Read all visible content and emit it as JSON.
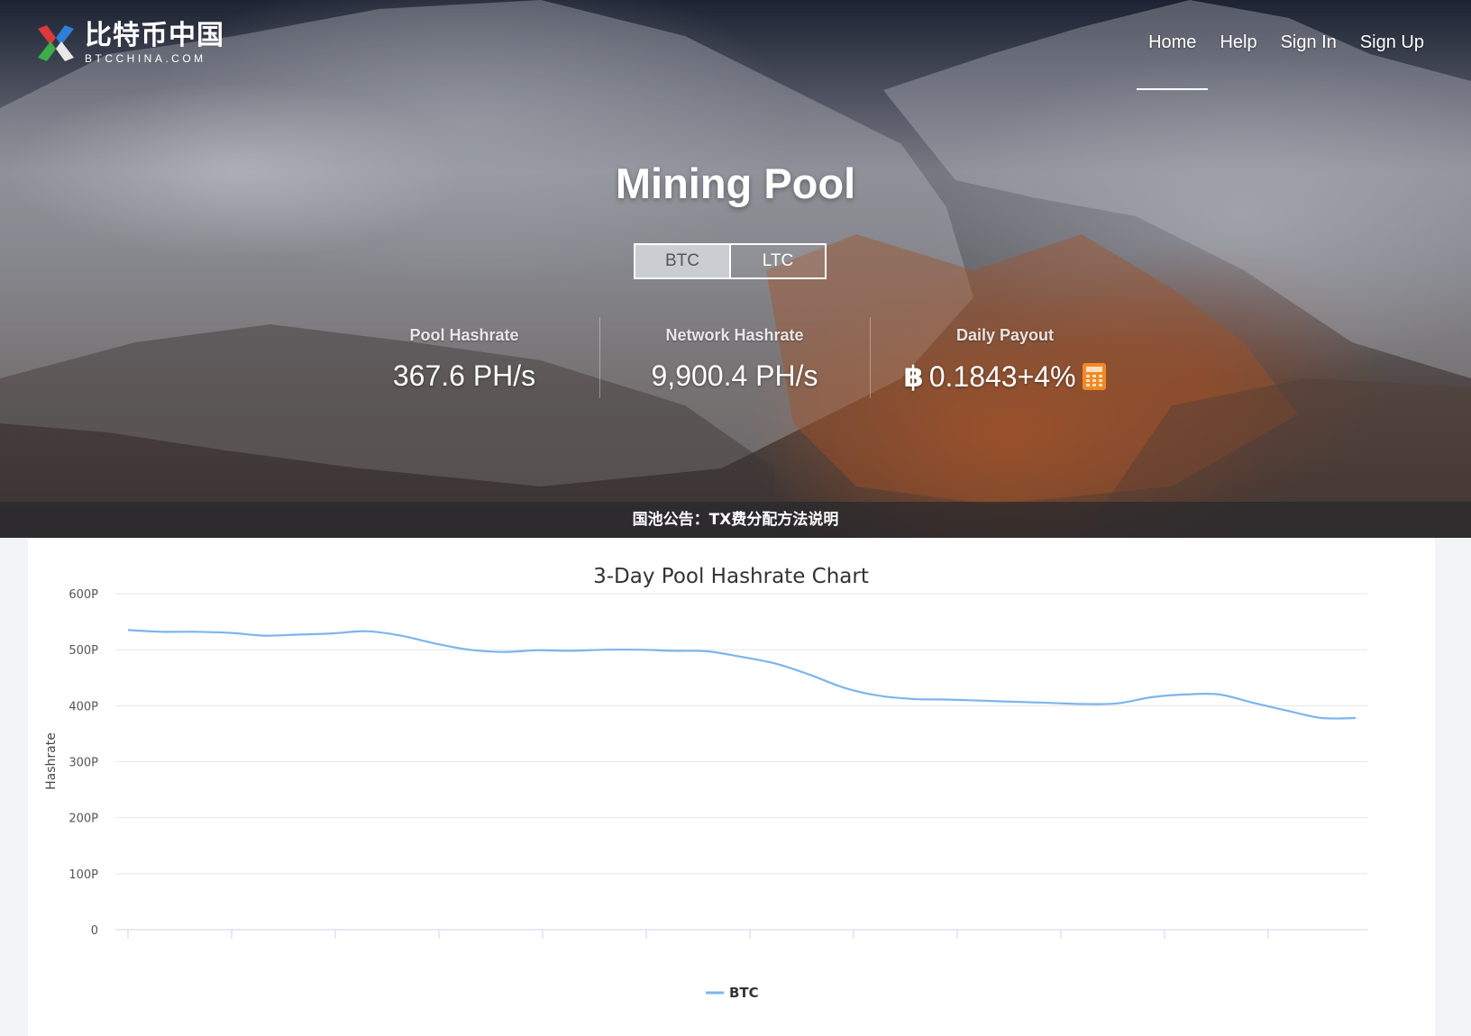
{
  "header": {
    "logo_cn": "比特币中国",
    "logo_en": "BTCCHINA.COM",
    "nav": [
      "Home",
      "Help",
      "Sign In",
      "Sign Up"
    ]
  },
  "hero": {
    "title": "Mining Pool",
    "toggle": [
      "BTC",
      "LTC"
    ],
    "stats": [
      {
        "label": "Pool Hashrate",
        "value": "367.6 PH/s"
      },
      {
        "label": "Network Hashrate",
        "value": "9,900.4 PH/s"
      },
      {
        "label": "Daily Payout",
        "value": "0.1843+4%",
        "currency_symbol": "฿"
      }
    ],
    "notice": "国池公告：TX费分配方法说明"
  },
  "colors": {
    "accent_orange": "#f08a24",
    "series_blue": "#7cb5ec"
  },
  "chart_data": {
    "type": "line",
    "title": "3-Day Pool Hashrate Chart",
    "ylabel": "Hashrate",
    "xlabel": "",
    "ylim": [
      0,
      600
    ],
    "yticks": [
      0,
      100,
      200,
      300,
      400,
      500,
      600
    ],
    "ytick_labels": [
      "0",
      "100P",
      "200P",
      "300P",
      "400P",
      "500P",
      "600P"
    ],
    "x_tick_count": 12,
    "grid": true,
    "legend_position": "bottom-center",
    "series": [
      {
        "name": "BTC",
        "x": [
          0,
          1,
          2,
          3,
          4,
          5,
          6,
          7,
          8,
          9,
          10,
          11,
          12,
          13,
          14,
          15,
          16,
          17,
          18,
          19,
          20,
          21,
          22,
          23,
          24,
          25,
          26,
          27,
          28,
          29,
          30,
          31,
          32,
          33,
          34,
          35,
          36
        ],
        "values": [
          535,
          532,
          532,
          530,
          525,
          527,
          529,
          533,
          525,
          511,
          500,
          496,
          499,
          498,
          500,
          500,
          498,
          497,
          487,
          475,
          455,
          432,
          418,
          412,
          411,
          409,
          407,
          405,
          403,
          404,
          415,
          420,
          420,
          405,
          391,
          378,
          378
        ]
      }
    ]
  }
}
